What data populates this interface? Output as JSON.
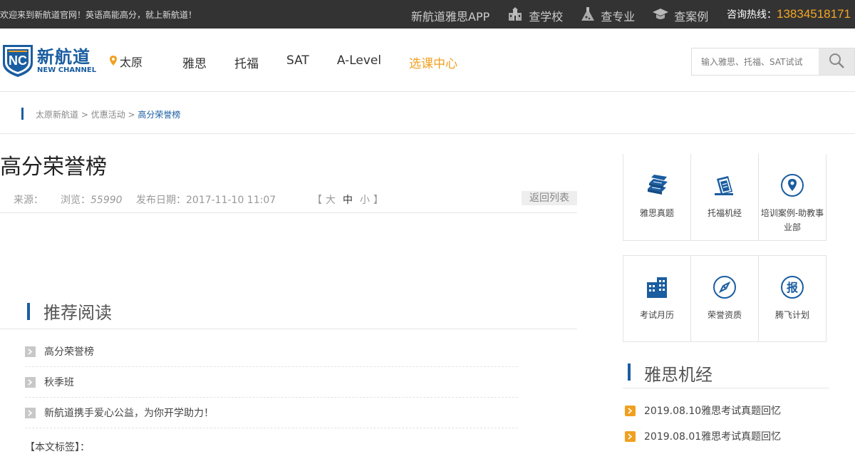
{
  "topbar": {
    "welcome": "欢迎来到新航道官网！英语高能高分，就上新航道！",
    "links": [
      {
        "label": "新航道雅思APP",
        "icon": ""
      },
      {
        "label": "查学校",
        "icon": "school-icon"
      },
      {
        "label": "查专业",
        "icon": "flask-icon"
      },
      {
        "label": "查案例",
        "icon": "graduation-cap-icon"
      }
    ],
    "hotline_label": "咨询热线：",
    "hotline_number": "13834518171"
  },
  "header": {
    "logo_cn": "新航道",
    "logo_en": "NEW CHANNEL",
    "city": "太原",
    "nav": [
      "雅思",
      "托福",
      "SAT",
      "A-Level",
      "选课中心"
    ],
    "nav_active_index": 4,
    "search_placeholder": "输入雅思、托福、SAT试试",
    "accent_color": "#1a5da0",
    "highlight_color": "#f0a020"
  },
  "breadcrumb": {
    "items": [
      "太原新航道",
      "优惠活动"
    ],
    "separator": " > ",
    "current": "高分荣誉榜"
  },
  "article": {
    "title": "高分荣誉榜",
    "source_label": "来源：",
    "views_label": "浏览：",
    "views": "55990",
    "date_label": "发布日期：",
    "date": "2017-11-10 11:07",
    "font_size_open": "【",
    "font_sizes": [
      "大",
      "中",
      "小"
    ],
    "font_size_close": "】",
    "back_label": "返回列表"
  },
  "recommend": {
    "title": "推荐阅读",
    "items": [
      "高分荣誉榜",
      "秋季班",
      "新航道携手爱心公益，为你开学助力！"
    ],
    "tags_label": "【本文标签】："
  },
  "sidebar": {
    "grid": [
      {
        "label": "雅思真题",
        "icon": "book-stack-icon"
      },
      {
        "label": "托福机经",
        "icon": "notebook-icon"
      },
      {
        "label": "培训案例-助教事业部",
        "icon": "location-pin-icon"
      },
      {
        "label": "考试月历",
        "icon": "building-icon"
      },
      {
        "label": "荣誉资质",
        "icon": "compass-icon"
      },
      {
        "label": "腾飞计划",
        "icon": "bao-badge-icon"
      }
    ],
    "news_title": "雅思机经",
    "news": [
      "2019.08.10雅思考试真题回忆",
      "2019.08.01雅思考试真题回忆"
    ]
  }
}
